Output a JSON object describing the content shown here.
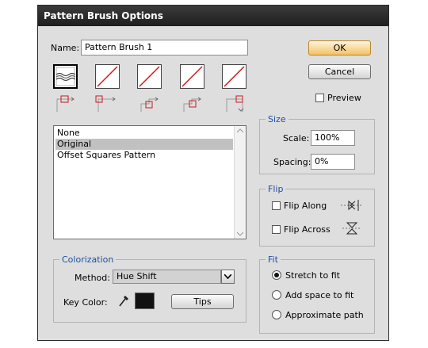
{
  "window": {
    "title": "Pattern Brush Options"
  },
  "name_field": {
    "label": "Name:",
    "value": "Pattern Brush 1"
  },
  "buttons": {
    "ok": "OK",
    "cancel": "Cancel",
    "tips": "Tips"
  },
  "preview": {
    "label": "Preview",
    "checked": false
  },
  "tiles": [
    {
      "name": "side-tile",
      "state": "selected"
    },
    {
      "name": "outer-corner-tile",
      "state": "none"
    },
    {
      "name": "inner-corner-tile",
      "state": "none"
    },
    {
      "name": "start-tile",
      "state": "none"
    },
    {
      "name": "end-tile",
      "state": "none"
    }
  ],
  "pattern_list": {
    "items": [
      "None",
      "Original",
      "Offset Squares Pattern"
    ],
    "selected_index": 1
  },
  "size": {
    "title": "Size",
    "scale_label": "Scale:",
    "scale_value": "100%",
    "spacing_label": "Spacing:",
    "spacing_value": "0%"
  },
  "flip": {
    "title": "Flip",
    "along_label": "Flip Along",
    "across_label": "Flip Across",
    "along_checked": false,
    "across_checked": false
  },
  "fit": {
    "title": "Fit",
    "options": [
      "Stretch to fit",
      "Add space to fit",
      "Approximate path"
    ],
    "selected_index": 0
  },
  "colorization": {
    "title": "Colorization",
    "method_label": "Method:",
    "method_value": "Hue Shift",
    "key_color_label": "Key Color:",
    "key_color": "#111111"
  }
}
